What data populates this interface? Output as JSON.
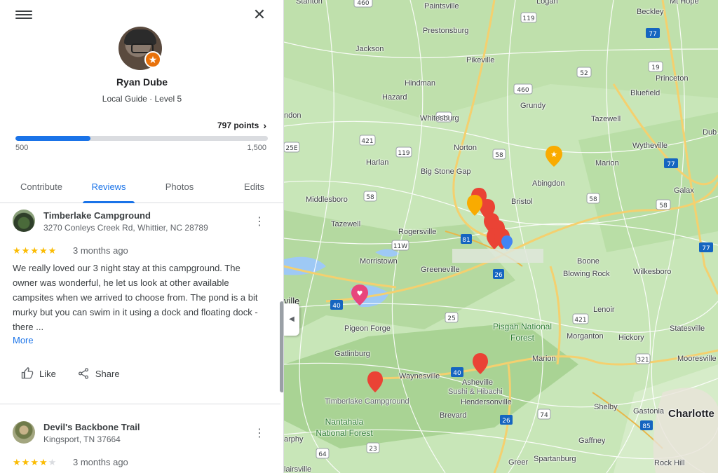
{
  "panel": {
    "user": {
      "name": "Ryan Dube",
      "level": "Local Guide · Level 5"
    },
    "points": {
      "label": "797 points",
      "min": "500",
      "max": "1,500",
      "fraction": 0.297
    },
    "tabs": [
      {
        "label": "Contribute"
      },
      {
        "label": "Reviews"
      },
      {
        "label": "Photos"
      },
      {
        "label": "Edits"
      }
    ],
    "reviews": [
      {
        "title": "Timberlake Campground",
        "address": "3270 Conleys Creek Rd, Whittier, NC 28789",
        "rating": 5,
        "when": "3 months ago",
        "text": "We really loved our 3 night stay at this campground. The owner was wonderful,  he let us look at other available campsites when we arrived to choose from. The pond is a bit murky but you can swim in it using a dock and floating dock - there ...",
        "more": "More",
        "like": "Like",
        "share": "Share"
      },
      {
        "title": "Devil's Backbone Trail",
        "address": "Kingsport, TN 37664",
        "rating": 4,
        "when": "3 months ago"
      }
    ]
  },
  "map": {
    "labels": [
      {
        "text": "Stanton"
      },
      {
        "text": "Paintsville"
      },
      {
        "text": "Logan"
      },
      {
        "text": "Mt Hope"
      },
      {
        "text": "Beckley"
      },
      {
        "text": "Prestonsburg"
      },
      {
        "text": "Jackson"
      },
      {
        "text": "Pikeville"
      },
      {
        "text": "Princeton"
      },
      {
        "text": "Hindman"
      },
      {
        "text": "Bluefield"
      },
      {
        "text": "Hazard"
      },
      {
        "text": "Grundy"
      },
      {
        "text": "Whitesburg"
      },
      {
        "text": "Tazewell"
      },
      {
        "text": "Norton"
      },
      {
        "text": "Wytheville"
      },
      {
        "text": "Harlan"
      },
      {
        "text": "Marion"
      },
      {
        "text": "Big Stone Gap"
      },
      {
        "text": "Abingdon"
      },
      {
        "text": "Middlesboro"
      },
      {
        "text": "Bristol"
      },
      {
        "text": "Galax"
      },
      {
        "text": "Tazewell"
      },
      {
        "text": "Rogersville"
      },
      {
        "text": "Morristown"
      },
      {
        "text": "Boone"
      },
      {
        "text": "Greeneville"
      },
      {
        "text": "Blowing Rock"
      },
      {
        "text": "Wilkesboro"
      },
      {
        "text": "Knoxville"
      },
      {
        "text": "Lenoir"
      },
      {
        "text": "Pigeon Forge"
      },
      {
        "text": "Statesville"
      },
      {
        "text": "Gatlinburg"
      },
      {
        "text": "Morganton"
      },
      {
        "text": "Hickory"
      },
      {
        "text": "Marion"
      },
      {
        "text": "Mooresville"
      },
      {
        "text": "Waynesville"
      },
      {
        "text": "Asheville"
      },
      {
        "text": "Hendersonville"
      },
      {
        "text": "Shelby"
      },
      {
        "text": "Gastonia"
      },
      {
        "text": "Charlotte"
      },
      {
        "text": "Brevard"
      },
      {
        "text": "Gaffney"
      },
      {
        "text": "Spartanburg"
      },
      {
        "text": "Greer"
      },
      {
        "text": "Rock Hill"
      },
      {
        "text": "Dub"
      },
      {
        "text": "Pisgah National Forest"
      },
      {
        "text": "Nantahala National Forest"
      },
      {
        "text": "Sushi & Hibachi"
      },
      {
        "text": "Timberlake Campground"
      },
      {
        "text": "Asheville"
      },
      {
        "text": "arphy"
      },
      {
        "text": "lairsville"
      },
      {
        "text": "ndon"
      },
      {
        "text": "ville"
      }
    ]
  },
  "colors": {
    "accent": "#1a73e8",
    "pin_red": "#ea4335",
    "pin_yellow": "#f9ab00",
    "pin_pink": "#e8467c",
    "badge_orange": "#e8710a",
    "star": "#fbbc04"
  }
}
